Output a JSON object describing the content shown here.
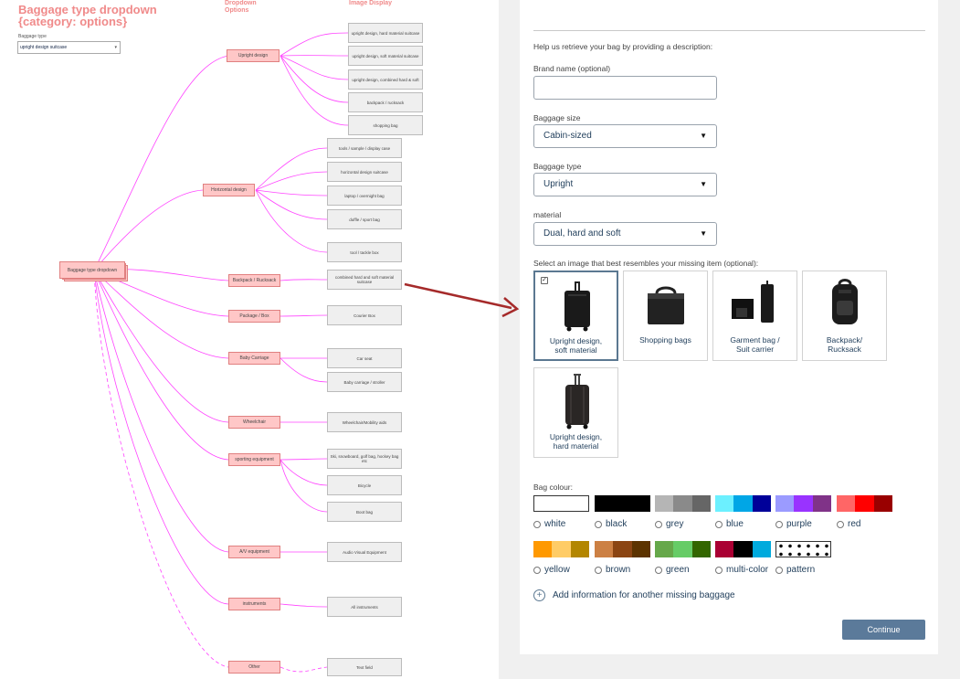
{
  "diagram": {
    "title_line1": "Baggage type dropdown",
    "title_line2": "{category: options}",
    "col_dropdown": "Dropdown",
    "col_options": "Options",
    "col_image": "Image Display",
    "field_label": "Baggage type",
    "field_value": "upright design suitcase",
    "root": "Baggage type dropdown",
    "categories": [
      "Upright design",
      "Horizontal design",
      "Backpack / Rucksack",
      "Package / Box",
      "Baby Carriage",
      "Wheelchair",
      "sporting equipment",
      "A/V equipment",
      "instruments",
      "Other"
    ],
    "options": [
      "upright design, hard material suitcase",
      "upright design, soft material suitcase",
      "upright design, combined hard & soft",
      "backpack / rucksack",
      "shopping bag",
      "tools / sample / display case",
      "horizontal design suitcase",
      "laptop / overnight bag",
      "duffle / sport bag",
      "tool / tackle box",
      "combined hard and soft material suitcase",
      "Courier Box",
      "Car seat",
      "Baby carriage / stroller",
      "Wheelchair/Mobility aids",
      "Ski, snowboard, golf bag, hockey bag etc",
      "Bicycle",
      "Boot bag",
      "Audio Visual Equipment",
      "All instruments",
      "Text field"
    ]
  },
  "form": {
    "intro": "Help us retrieve your bag by providing a description:",
    "brand_label": "Brand name (optional)",
    "brand_value": "",
    "size_label": "Baggage size",
    "size_value": "Cabin-sized",
    "type_label": "Baggage type",
    "type_value": "Upright",
    "material_label": "material",
    "material_value": "Dual, hard and soft",
    "image_prompt": "Select an image that best resembles your missing item (optional):",
    "tiles": [
      {
        "line1": "Upright design,",
        "line2": "soft material",
        "selected": true
      },
      {
        "line1": "Shopping bags",
        "line2": "",
        "selected": false
      },
      {
        "line1": "Garment bag /",
        "line2": "Suit carrier",
        "selected": false
      },
      {
        "line1": "Backpack/",
        "line2": "Rucksack",
        "selected": false
      },
      {
        "line1": "Upright design,",
        "line2": "hard material",
        "selected": false
      }
    ],
    "colour_label": "Bag colour:",
    "colours": [
      {
        "label": "white",
        "swatch": [
          "#ffffff"
        ]
      },
      {
        "label": "black",
        "swatch": [
          "#000000"
        ]
      },
      {
        "label": "grey",
        "swatch": [
          "#b5b5b5",
          "#8a8a8a",
          "#666666"
        ]
      },
      {
        "label": "blue",
        "swatch": [
          "#6cf0ff",
          "#00a6e6",
          "#000099"
        ]
      },
      {
        "label": "purple",
        "swatch": [
          "#9b9bff",
          "#9933ff",
          "#803388"
        ]
      },
      {
        "label": "red",
        "swatch": [
          "#ff6666",
          "#ff0000",
          "#990000"
        ]
      },
      {
        "label": "yellow",
        "swatch": [
          "#ff9900",
          "#ffcc66",
          "#b38600"
        ]
      },
      {
        "label": "brown",
        "swatch": [
          "#cc8044",
          "#8b4513",
          "#5c3300"
        ]
      },
      {
        "label": "green",
        "swatch": [
          "#66a84a",
          "#66cc66",
          "#336600"
        ]
      },
      {
        "label": "multi-color",
        "swatch": [
          "#aa0033",
          "#000000",
          "#00aadd"
        ]
      },
      {
        "label": "pattern",
        "swatch": [
          "#ffffff"
        ]
      }
    ],
    "add_more": "Add information for another missing baggage",
    "continue_label": "Continue",
    "accent": "#5b7a9a"
  }
}
